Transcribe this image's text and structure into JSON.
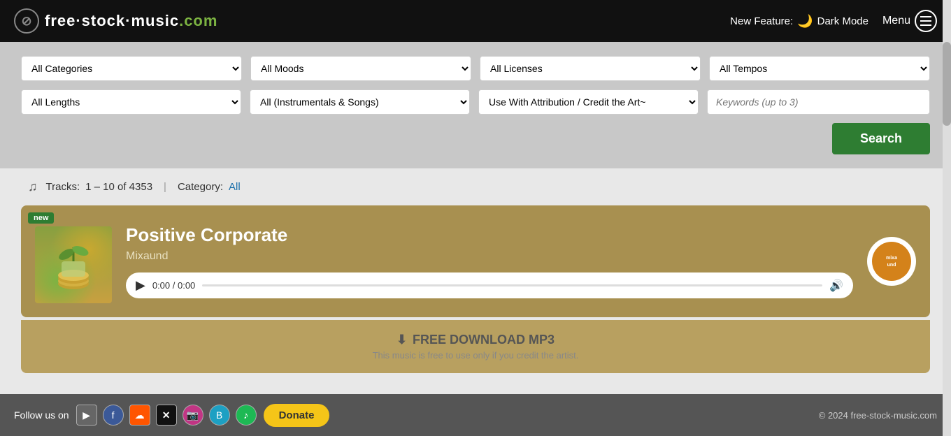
{
  "header": {
    "logo_text": "free·stock·music",
    "logo_com": ".com",
    "new_feature_label": "New Feature:",
    "dark_mode_label": "Dark Mode",
    "menu_label": "Menu"
  },
  "filters": {
    "categories_label": "All Categories",
    "moods_label": "All Moods",
    "licenses_label": "All Licenses",
    "tempos_label": "All Tempos",
    "lengths_label": "All Lengths",
    "types_label": "All (Instrumentals & Songs)",
    "usage_label": "Use With Attribution / Credit the Art~",
    "keywords_placeholder": "Keywords (up to 3)",
    "search_label": "Search"
  },
  "tracks_bar": {
    "tracks_label": "Tracks:",
    "range": "1 – 10 of 4353",
    "divider": "|",
    "category_label": "Category:",
    "category_value": "All"
  },
  "track": {
    "badge": "new",
    "title": "Positive Corporate",
    "artist": "Mixaund",
    "time": "0:00 / 0:00",
    "artist_logo_text": "mixaund",
    "download_label": "FREE DOWNLOAD  MP3",
    "download_sub": "This music is free to use only if you credit the artist."
  },
  "footer": {
    "follow_label": "Follow us on",
    "donate_label": "Donate",
    "copyright": "© 2024  free-stock-music.com"
  }
}
